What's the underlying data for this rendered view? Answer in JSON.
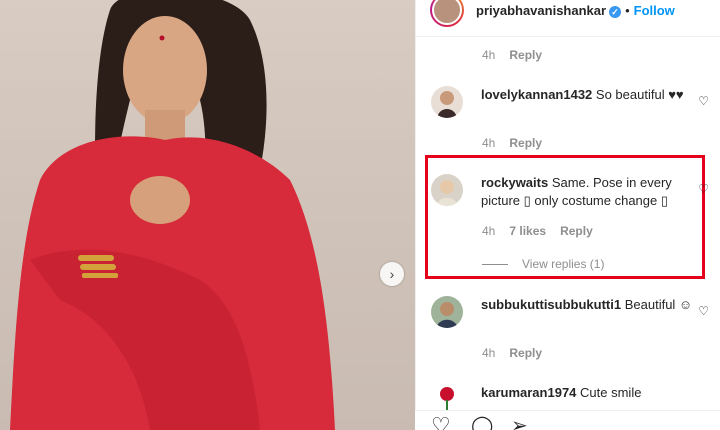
{
  "post": {
    "username": "priyabhavanishankar",
    "verified_glyph": "✓",
    "separator": "•",
    "follow_label": "Follow"
  },
  "carousel": {
    "next_glyph": "›"
  },
  "top_meta": {
    "time": "4h",
    "reply": "Reply"
  },
  "comments": [
    {
      "username": "lovelykannan1432",
      "text": "So beautiful ♥♥",
      "time": "4h",
      "reply": "Reply"
    },
    {
      "username": "rockywaits",
      "text": "Same. Pose in every picture ▯ only costume change ▯",
      "time": "4h",
      "likes": "7 likes",
      "reply": "Reply",
      "view_replies": "View replies (1)"
    },
    {
      "username": "subbukuttisubbukutti1",
      "text": "Beautiful ☺",
      "time": "4h",
      "reply": "Reply"
    },
    {
      "username": "karumaran1974",
      "text": "Cute smile"
    }
  ],
  "icons": {
    "heart": "♡",
    "like": "♡",
    "comment": "◯",
    "share": "➢"
  },
  "colors": {
    "highlight": "#e5001b",
    "follow": "#0095f6",
    "dress": "#d72a3a"
  }
}
